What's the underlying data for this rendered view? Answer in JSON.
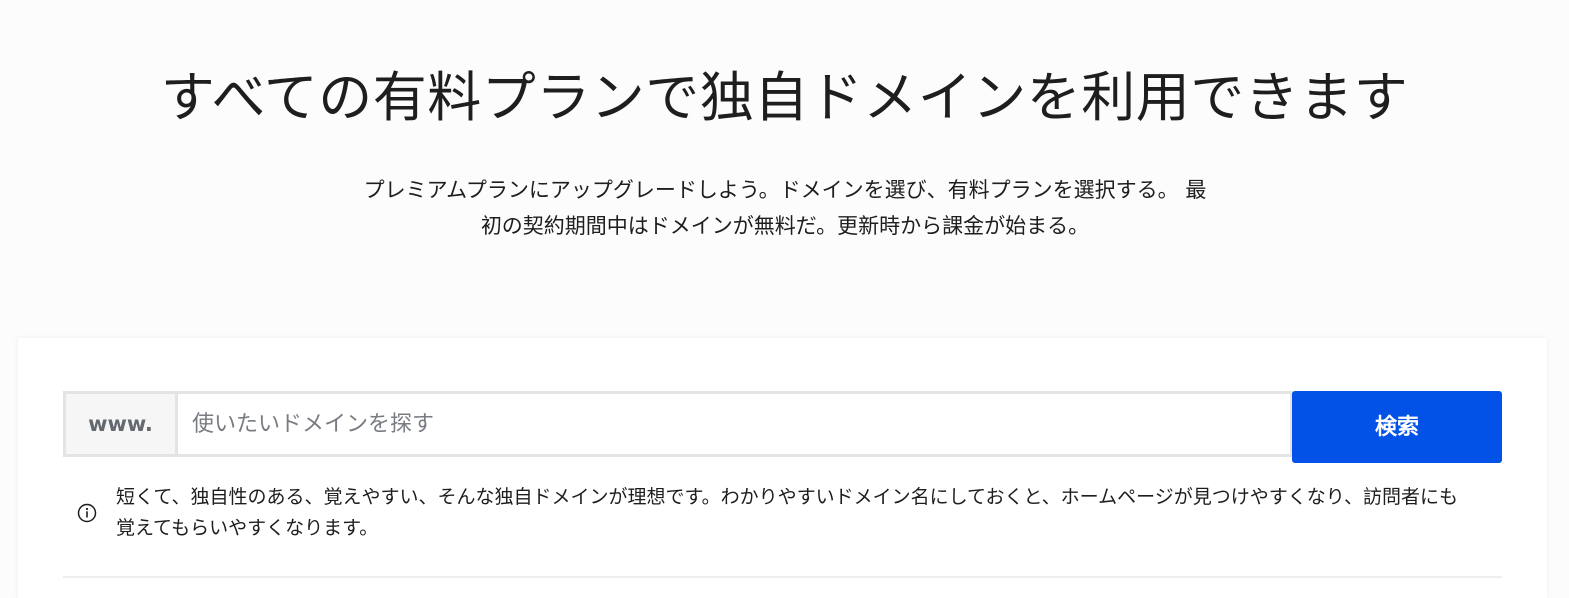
{
  "hero": {
    "title": "すべての有料プランで独自ドメインを利用できます",
    "subtitle": "プレミアムプランにアップグレードしよう。ドメインを選び、有料プランを選択する。 最初の契約期間中はドメインが無料だ。更新時から課金が始まる。"
  },
  "search": {
    "prefix": "www.",
    "placeholder": "使いたいドメインを探す",
    "value": "",
    "button_label": "検索"
  },
  "hint": {
    "icon": "info-icon",
    "text": "短くて、独自性のある、覚えやすい、そんな独自ドメインが理想です。わかりやすいドメイン名にしておくと、ホームページが見つけやすくなり、訪問者にも覚えてもらいやすくなります。"
  },
  "colors": {
    "accent": "#0352e8",
    "background": "#fcfcfc",
    "card": "#ffffff",
    "text": "#1e1e1e"
  }
}
